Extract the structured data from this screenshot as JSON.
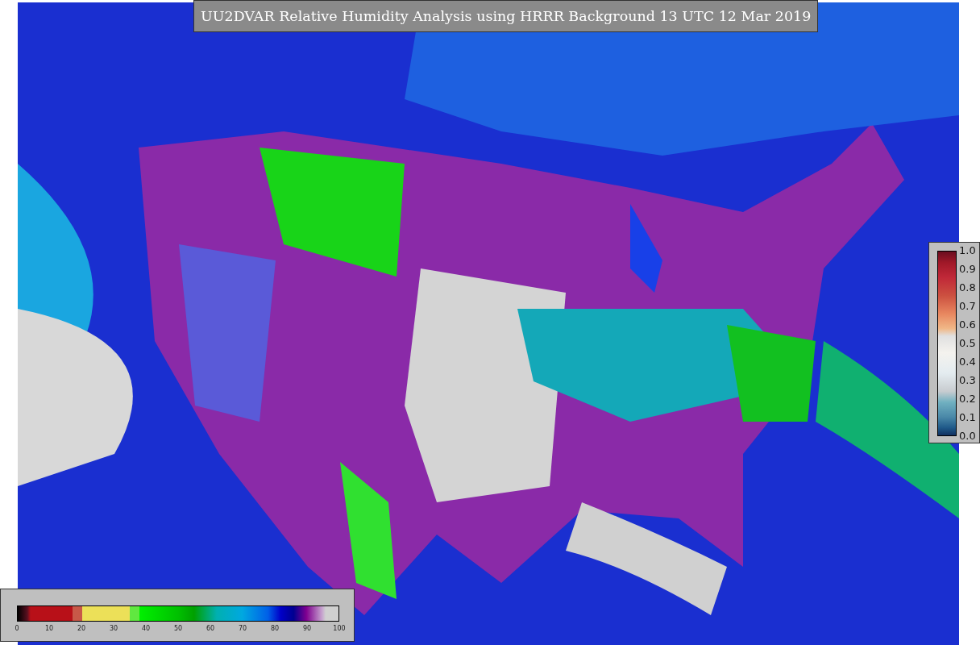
{
  "title": "UU2DVAR Relative Humidity Analysis using HRRR Background 13 UTC 12 Mar 2019",
  "humidity_colorbar": {
    "ticks": [
      "0",
      "10",
      "20",
      "30",
      "40",
      "50",
      "60",
      "70",
      "80",
      "90",
      "100"
    ]
  },
  "observation_colorbar": {
    "ticks": [
      "1.0",
      "0.9",
      "0.8",
      "0.7",
      "0.6",
      "0.5",
      "0.4",
      "0.3",
      "0.2",
      "0.1",
      "0.0"
    ]
  }
}
